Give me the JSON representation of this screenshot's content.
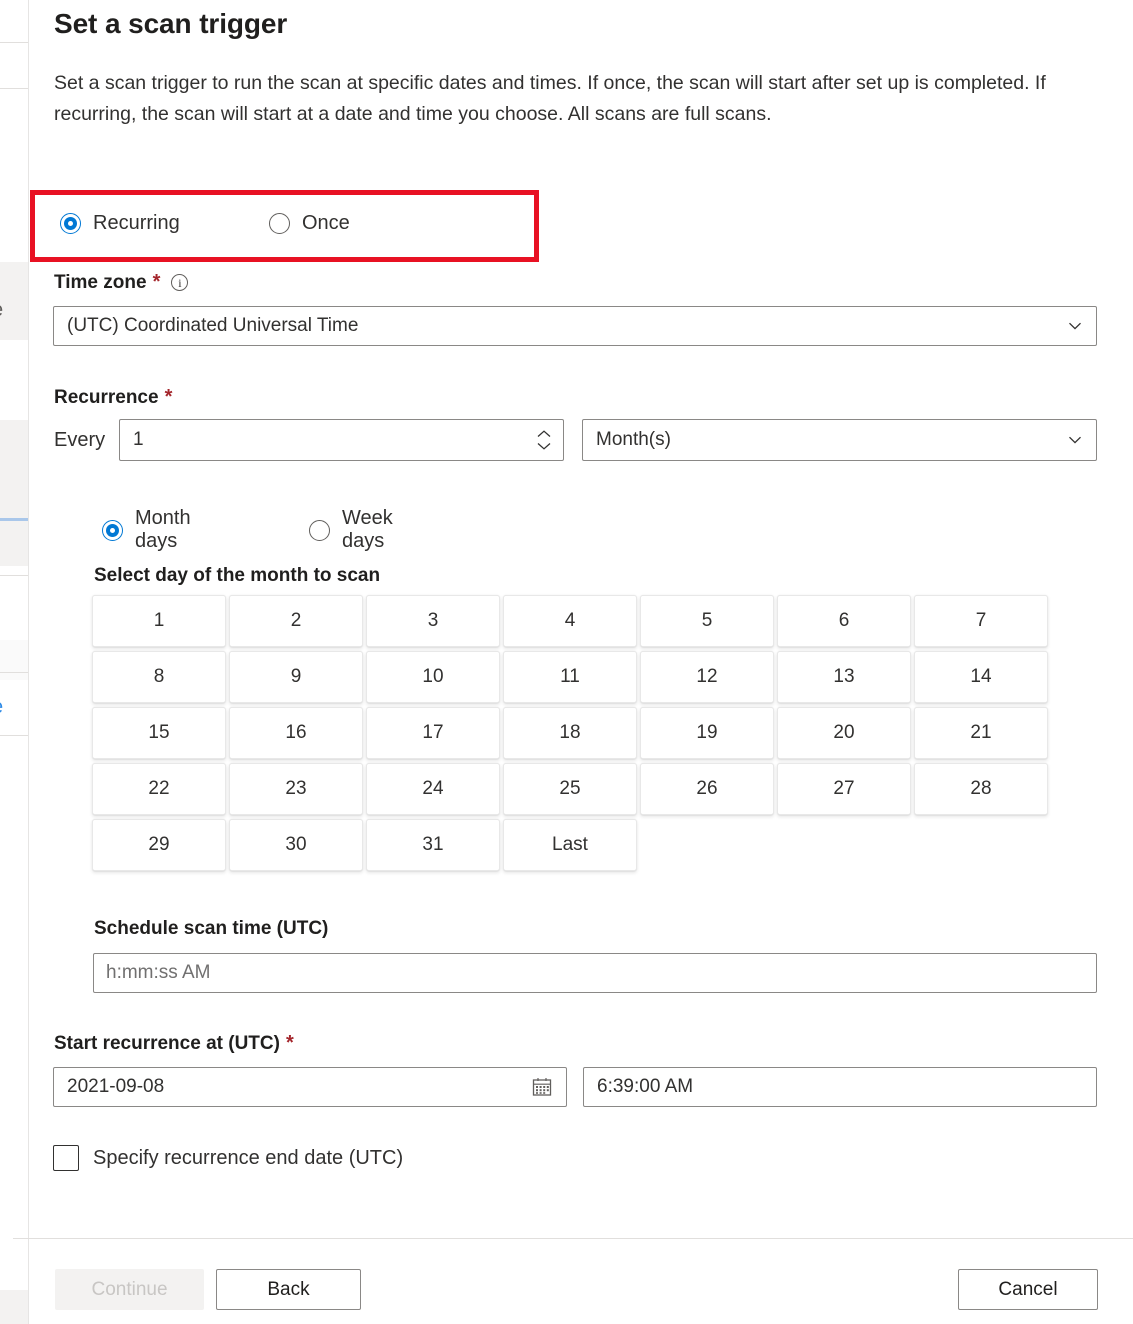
{
  "dialog": {
    "title": "Set a scan trigger",
    "description": "Set a scan trigger to run the scan at specific dates and times. If once, the scan will start after set up is completed. If recurring, the scan will start at a date and time you choose. All scans are full scans."
  },
  "highlight_color": "#e81123",
  "accent_color": "#0078d4",
  "trigger_type": {
    "options": [
      {
        "label": "Recurring",
        "selected": true
      },
      {
        "label": "Once",
        "selected": false
      }
    ]
  },
  "time_zone": {
    "label": "Time zone",
    "required_marker": "*",
    "info_icon": "info-icon",
    "value": "(UTC) Coordinated Universal Time",
    "chevron": "chevron-down-icon"
  },
  "recurrence": {
    "label": "Recurrence",
    "required_marker": "*",
    "every_label": "Every",
    "interval_value": "1",
    "spinner_up": "chevron-up-icon",
    "spinner_down": "chevron-down-icon",
    "unit_value": "Month(s)",
    "unit_chevron": "chevron-down-icon",
    "mode_options": [
      {
        "label": "Month days",
        "selected": true
      },
      {
        "label": "Week days",
        "selected": false
      }
    ]
  },
  "month_days": {
    "heading": "Select day of the month to scan",
    "days": [
      "1",
      "2",
      "3",
      "4",
      "5",
      "6",
      "7",
      "8",
      "9",
      "10",
      "11",
      "12",
      "13",
      "14",
      "15",
      "16",
      "17",
      "18",
      "19",
      "20",
      "21",
      "22",
      "23",
      "24",
      "25",
      "26",
      "27",
      "28",
      "29",
      "30",
      "31",
      "Last"
    ]
  },
  "schedule_scan_time": {
    "label": "Schedule scan time (UTC)",
    "value": "",
    "placeholder": "h:mm:ss AM"
  },
  "start_recurrence": {
    "label": "Start recurrence at (UTC)",
    "required_marker": "*",
    "date_value": "2021-09-08",
    "calendar_icon": "calendar-icon",
    "time_value": "6:39:00 AM"
  },
  "end_date_checkbox": {
    "label": "Specify recurrence end date (UTC)",
    "checked": false
  },
  "footer": {
    "continue_label": "Continue",
    "continue_disabled": true,
    "back_label": "Back",
    "cancel_label": "Cancel"
  },
  "background_fragments": {
    "frag_a": "e",
    "frag_b": "o",
    "frag_c": "e"
  }
}
